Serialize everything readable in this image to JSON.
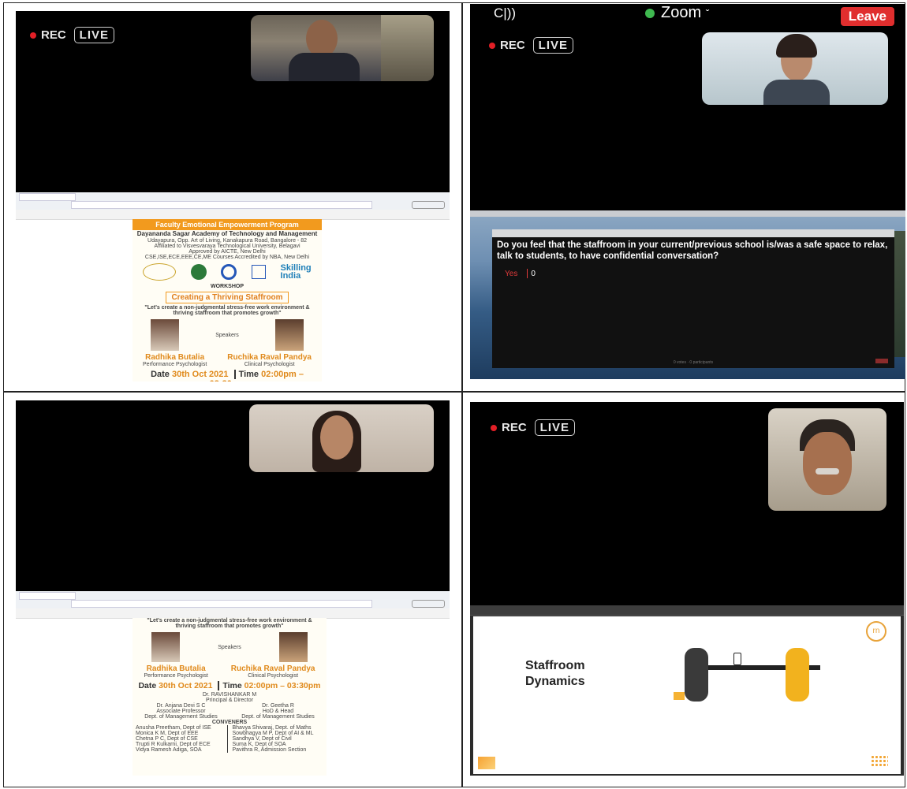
{
  "rec": {
    "rec_label": "REC",
    "live_label": "LIVE"
  },
  "zoom": {
    "app_name": "Zoom",
    "chevron": "ˇ",
    "leave_label": "Leave",
    "audio_glyph": "C|))"
  },
  "poster": {
    "program_title": "Faculty Emotional Empowerment Program",
    "college_name": "Dayananda Sagar Academy of Technology and Management",
    "address": "Udayapura, Opp. Art of Living, Kanakapura Road, Bangalore - 82",
    "affiliation": "Affiliated to Visvesvaraya Technological University, Belagavi",
    "approval": "Approved by AICTE, New Delhi",
    "accreditation": "CSE,ISE,ECE,EEE,CE,ME Courses Accredited by NBA, New Delhi",
    "skilling": "Skilling",
    "india": "India",
    "workshop_label": "WORKSHOP",
    "workshop_title": "Creating a Thriving Staffroom",
    "tagline": "\"Let's create a non-judgmental stress-free work environment & thriving staffroom that promotes growth\"",
    "speakers_label": "Speakers",
    "speaker1_name": "Radhika Butalia",
    "speaker1_role": "Performance Psychologist",
    "speaker2_name": "Ruchika Raval Pandya",
    "speaker2_role": "Clinical Psychologist",
    "date_label": "Date",
    "date_value": "30th Oct 2021",
    "time_label": "Time",
    "time_value": "02:00pm – 03:30pm",
    "principal_name": "Dr. RAVISHANKAR M",
    "principal_role": "Principal & Director",
    "coord1_name": "Dr. Anjana Devi S C",
    "coord1_role": "Associate Professor",
    "coord1_dept": "Dept. of Management Studies",
    "coord2_name": "Dr. Geetha R",
    "coord2_role": "HoD & Head",
    "coord2_dept": "Dept. of Management Studies",
    "conveners_label": "CONVENERS",
    "conveners_left": [
      "Anusha Preetham, Dept of ISE",
      "Monica K M, Dept of EEE",
      "Chetna P C, Dept of CSE",
      "Trupti R Kulkarni, Dept of ECE",
      "Vidya Ramesh Adiga, SOA"
    ],
    "conveners_right": [
      "Bhavya Shivaraj, Dept. of Maths",
      "Sowbhagya M P, Dept of AI & ML",
      "Sandhya V, Dept of Civil",
      "Suma K, Dept of SOA",
      "Pavithra R, Admission Section"
    ]
  },
  "poll": {
    "question": "Do you feel that the staffroom in your current/previous school is/was a safe space to relax, talk to students, to have confidential conversation?",
    "option_label": "Yes",
    "option_count": "0",
    "footer": "0 votes · 0 participants"
  },
  "slide": {
    "title_line1": "Staffroom",
    "title_line2": "Dynamics",
    "logo_text": "rn"
  },
  "colors": {
    "rec_red": "#e21f26",
    "leave_red": "#e02e2e",
    "poster_orange": "#f29a1e",
    "zoom_green": "#3fb950"
  }
}
